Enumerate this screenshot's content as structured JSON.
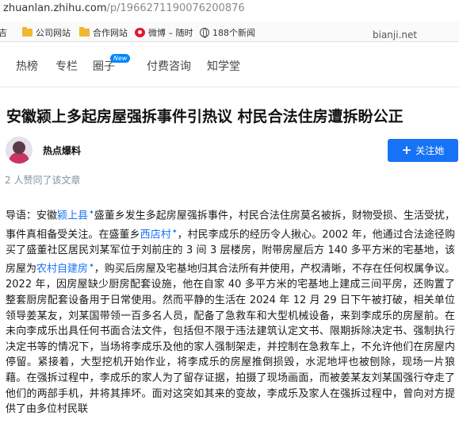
{
  "browser": {
    "url_host": "zhuanlan.zhihu.com",
    "url_path": "/p/1966271190076200876",
    "bookmarks": [
      {
        "label": "吉",
        "icon": "folder-icon"
      },
      {
        "label": "公司网站",
        "icon": "folder-icon"
      },
      {
        "label": "合作网站",
        "icon": "folder-icon"
      },
      {
        "label": "微博 – 随时",
        "icon": "weibo-icon"
      },
      {
        "label": "188个新闻",
        "icon": "globe-icon"
      },
      {
        "label": "bianji.net",
        "icon": ""
      }
    ]
  },
  "nav": {
    "items": [
      "热榜",
      "专栏",
      "圈子",
      "付费咨询",
      "知学堂"
    ],
    "new_badge": "New"
  },
  "article": {
    "title": "安徽颍上多起房屋强拆事件引热议 村民合法住房遭拆盼公正",
    "author": "热点爆料",
    "follow_label": "关注她",
    "likes": "2 人赞同了该文章",
    "body": {
      "s1": "导语：安徽",
      "link1": "颍上县",
      "s2": "盛董乡发生多起房屋强拆事件，村民合法住房莫名被拆，财物受损、生活受扰，事件真相备受关注。在盛董乡",
      "link2": "西店村",
      "s3": "，村民李成乐的经历令人揪心。2002 年，他通过合法途径购买了盛董社区居民刘某军位于刘前庄的 3 间 3 层楼房，附带房屋后方 140 多平方米的宅基地，该房屋为",
      "link3": "农村自建房",
      "s4": "，购买后房屋及宅基地归其合法所有并使用，产权清晰，不存在任何权属争议。2022 年，因房屋缺少厨房配套设施，他在自家 40 多平方米的宅基地上建成三间平房，还购置了整套厨房配套设备用于日常使用。然而平静的生活在 2024 年 12 月 29 日下午被打破，相关单位领导姜某友，刘某国带领一百多名人员，配备了急救车和大型机械设备，来到李成乐的房屋前。在未向李成乐出具任何书面合法文件，包括但不限于违法建筑认定文书、限期拆除决定书、强制执行决定书等的情况下，当场将李成乐及他的家人强制架走，并控制在急救车上，不允许他们在房屋内停留。紧接着，大型挖机开始作业，将李成乐的房屋推倒损毁，水泥地坪也被刨除，现场一片狼藉。在强拆过程中，李成乐的家人为了留存证据，拍摄了现场画面，而被姜某友刘某国强行夺走了他们的两部手机，并将其摔坏。面对这突如其来的变故，李成乐及家人在强拆过程中，曾向对方提供了由多位村民联"
    }
  }
}
